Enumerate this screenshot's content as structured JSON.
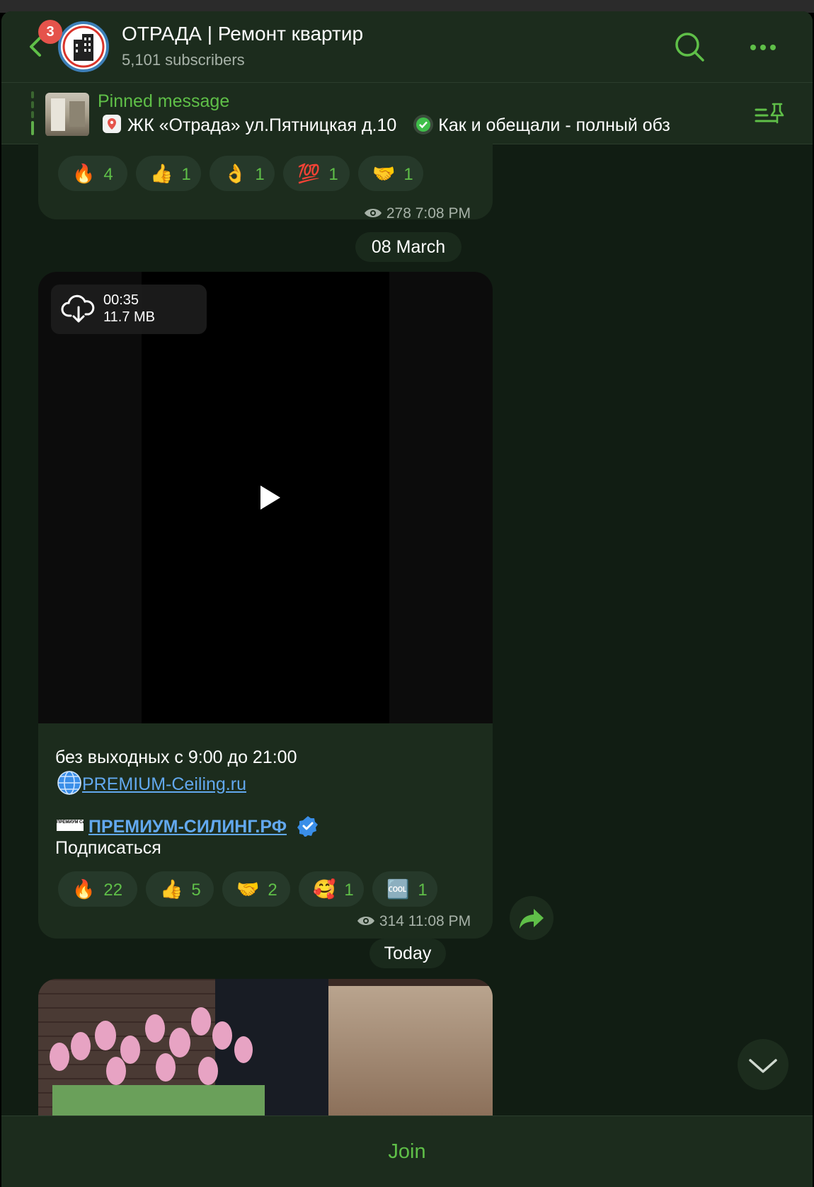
{
  "header": {
    "badge_count": "3",
    "title": "ОТРАДА | Ремонт квартир",
    "subscribers": "5,101 subscribers"
  },
  "pinned": {
    "label": "Pinned message",
    "text": "ЖК «Отрада» ул.Пятницкая д.10",
    "text2": "Как и обещали - полный обз"
  },
  "message1": {
    "reactions": [
      {
        "emoji": "🔥",
        "count": "4"
      },
      {
        "emoji": "👍",
        "count": "1"
      },
      {
        "emoji": "👌",
        "count": "1"
      },
      {
        "emoji": "💯",
        "count": "1"
      },
      {
        "emoji": "🤝",
        "count": "1"
      }
    ],
    "views": "278",
    "time": "7:08 PM"
  },
  "date1": "08 March",
  "message2": {
    "video_duration": "00:35",
    "video_size": "11.7 MB",
    "line1": "без выходных с 9:00 до 21:00",
    "link1": "PREMIUM-Ceiling.ru",
    "logo_text": "ПРЕМИУМ Силинг",
    "link2": "ПРЕМИУМ-СИЛИНГ.РФ",
    "subscribe": "Подписаться",
    "reactions": [
      {
        "emoji": "🔥",
        "count": "22"
      },
      {
        "emoji": "👍",
        "count": "5"
      },
      {
        "emoji": "🤝",
        "count": "2"
      },
      {
        "emoji": "🥰",
        "count": "1"
      },
      {
        "emoji": "🆒",
        "count": "1"
      }
    ],
    "views": "314",
    "time": "11:08 PM"
  },
  "date2": "Today",
  "footer": {
    "join_label": "Join"
  },
  "colors": {
    "accent": "#5fbf48",
    "link": "#62a8ee",
    "bubble": "#1c2c1d",
    "background": "#111d13"
  }
}
